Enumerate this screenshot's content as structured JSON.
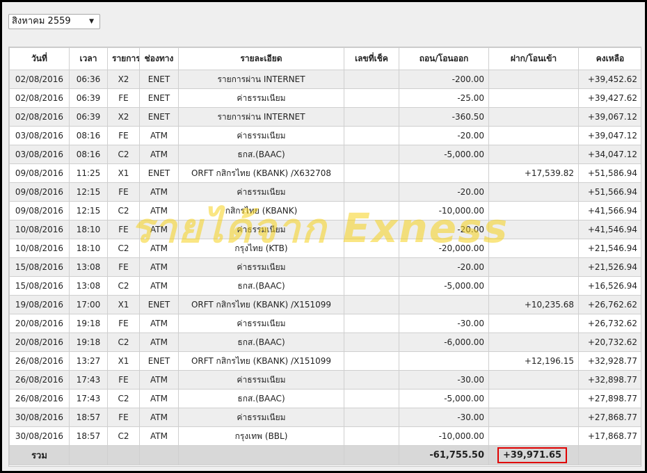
{
  "month_select": {
    "value": "สิงหาคม 2559",
    "arrow": "▼"
  },
  "table": {
    "headers": [
      "วันที่",
      "เวลา",
      "รายการ",
      "ช่องทาง",
      "รายละเอียด",
      "เลขที่เช็ค",
      "ถอน/โอนออก",
      "ฝาก/โอนเข้า",
      "คงเหลือ"
    ],
    "rows": [
      [
        "02/08/2016",
        "06:36",
        "X2",
        "ENET",
        "รายการผ่าน INTERNET",
        "",
        "-200.00",
        "",
        "+39,452.62"
      ],
      [
        "02/08/2016",
        "06:39",
        "FE",
        "ENET",
        "ค่าธรรมเนียม",
        "",
        "-25.00",
        "",
        "+39,427.62"
      ],
      [
        "02/08/2016",
        "06:39",
        "X2",
        "ENET",
        "รายการผ่าน INTERNET",
        "",
        "-360.50",
        "",
        "+39,067.12"
      ],
      [
        "03/08/2016",
        "08:16",
        "FE",
        "ATM",
        "ค่าธรรมเนียม",
        "",
        "-20.00",
        "",
        "+39,047.12"
      ],
      [
        "03/08/2016",
        "08:16",
        "C2",
        "ATM",
        "ธกส.(BAAC)",
        "",
        "-5,000.00",
        "",
        "+34,047.12"
      ],
      [
        "09/08/2016",
        "11:25",
        "X1",
        "ENET",
        "ORFT กสิกรไทย (KBANK) /X632708",
        "",
        "",
        "+17,539.82",
        "+51,586.94"
      ],
      [
        "09/08/2016",
        "12:15",
        "FE",
        "ATM",
        "ค่าธรรมเนียม",
        "",
        "-20.00",
        "",
        "+51,566.94"
      ],
      [
        "09/08/2016",
        "12:15",
        "C2",
        "ATM",
        "กสิกรไทย (KBANK)",
        "",
        "-10,000.00",
        "",
        "+41,566.94"
      ],
      [
        "10/08/2016",
        "18:10",
        "FE",
        "ATM",
        "ค่าธรรมเนียม",
        "",
        "-20.00",
        "",
        "+41,546.94"
      ],
      [
        "10/08/2016",
        "18:10",
        "C2",
        "ATM",
        "กรุงไทย (KTB)",
        "",
        "-20,000.00",
        "",
        "+21,546.94"
      ],
      [
        "15/08/2016",
        "13:08",
        "FE",
        "ATM",
        "ค่าธรรมเนียม",
        "",
        "-20.00",
        "",
        "+21,526.94"
      ],
      [
        "15/08/2016",
        "13:08",
        "C2",
        "ATM",
        "ธกส.(BAAC)",
        "",
        "-5,000.00",
        "",
        "+16,526.94"
      ],
      [
        "19/08/2016",
        "17:00",
        "X1",
        "ENET",
        "ORFT กสิกรไทย (KBANK) /X151099",
        "",
        "",
        "+10,235.68",
        "+26,762.62"
      ],
      [
        "20/08/2016",
        "19:18",
        "FE",
        "ATM",
        "ค่าธรรมเนียม",
        "",
        "-30.00",
        "",
        "+26,732.62"
      ],
      [
        "20/08/2016",
        "19:18",
        "C2",
        "ATM",
        "ธกส.(BAAC)",
        "",
        "-6,000.00",
        "",
        "+20,732.62"
      ],
      [
        "26/08/2016",
        "13:27",
        "X1",
        "ENET",
        "ORFT กสิกรไทย (KBANK) /X151099",
        "",
        "",
        "+12,196.15",
        "+32,928.77"
      ],
      [
        "26/08/2016",
        "17:43",
        "FE",
        "ATM",
        "ค่าธรรมเนียม",
        "",
        "-30.00",
        "",
        "+32,898.77"
      ],
      [
        "26/08/2016",
        "17:43",
        "C2",
        "ATM",
        "ธกส.(BAAC)",
        "",
        "-5,000.00",
        "",
        "+27,898.77"
      ],
      [
        "30/08/2016",
        "18:57",
        "FE",
        "ATM",
        "ค่าธรรมเนียม",
        "",
        "-30.00",
        "",
        "+27,868.77"
      ],
      [
        "30/08/2016",
        "18:57",
        "C2",
        "ATM",
        "กรุงเทพ (BBL)",
        "",
        "-10,000.00",
        "",
        "+17,868.77"
      ]
    ],
    "footer": {
      "label": "รวม",
      "withdraw_total": "-61,755.50",
      "deposit_total": "+39,971.65"
    }
  },
  "watermark": "รายได้จาก Exness",
  "colors": {
    "highlight_border": "#e00000",
    "watermark": "#f5d21e"
  }
}
